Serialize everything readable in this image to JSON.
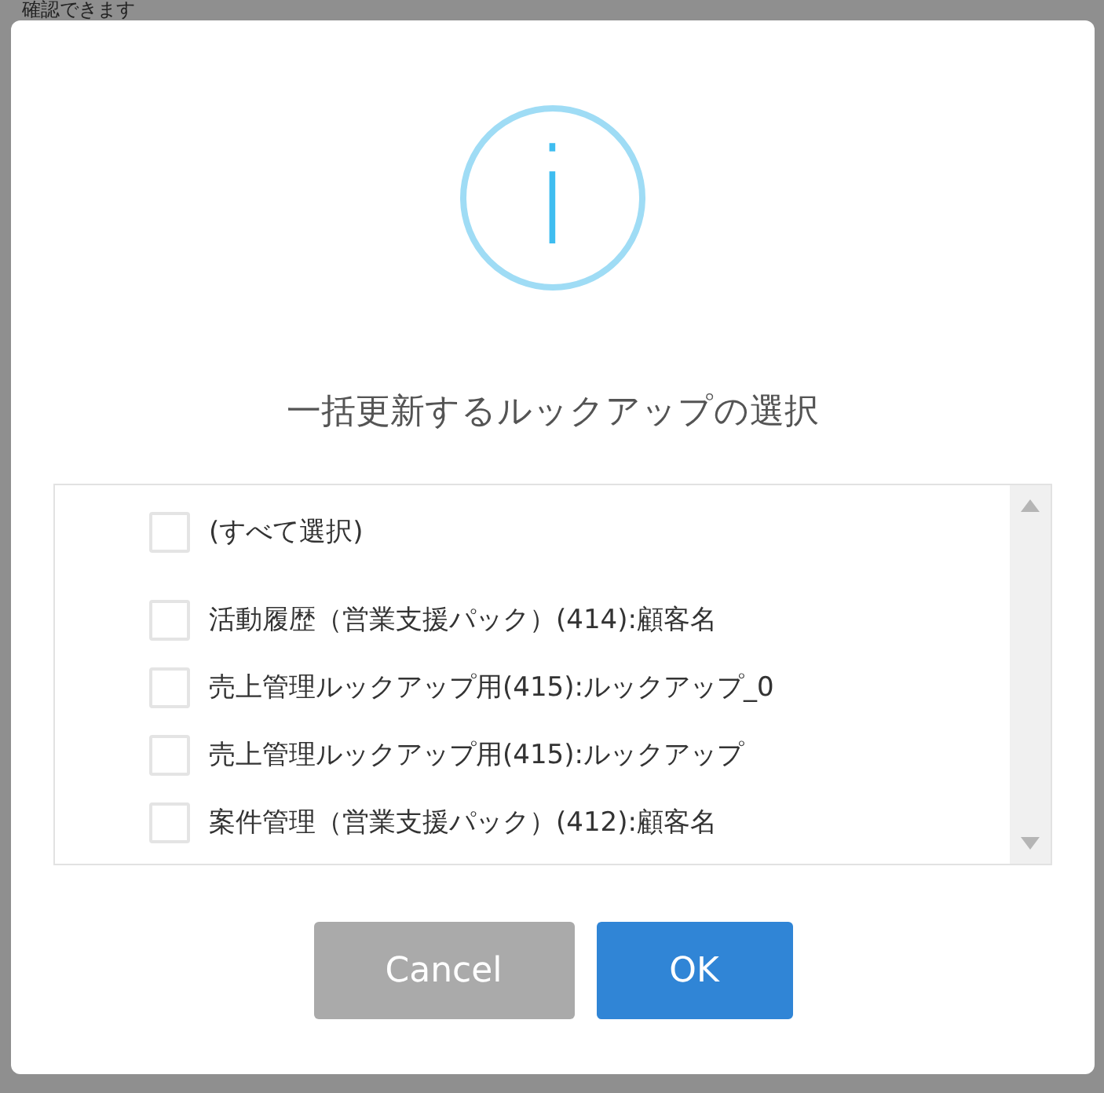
{
  "background": {
    "text": "確認できます"
  },
  "dialog": {
    "icon": "i",
    "title": "一括更新するルックアップの選択",
    "options": [
      {
        "kind": "select-all",
        "label": "(すべて選択)",
        "checked": false
      },
      {
        "kind": "item",
        "label": "活動履歴（営業支援パック）(414):顧客名",
        "checked": false
      },
      {
        "kind": "item",
        "label": "売上管理ルックアップ用(415):ルックアップ_0",
        "checked": false
      },
      {
        "kind": "item",
        "label": "売上管理ルックアップ用(415):ルックアップ",
        "checked": false
      },
      {
        "kind": "item",
        "label": "案件管理（営業支援パック）(412):顧客名",
        "checked": false
      }
    ],
    "buttons": [
      {
        "kind": "cancel",
        "label": "Cancel"
      },
      {
        "kind": "confirm",
        "label": "OK"
      }
    ]
  }
}
